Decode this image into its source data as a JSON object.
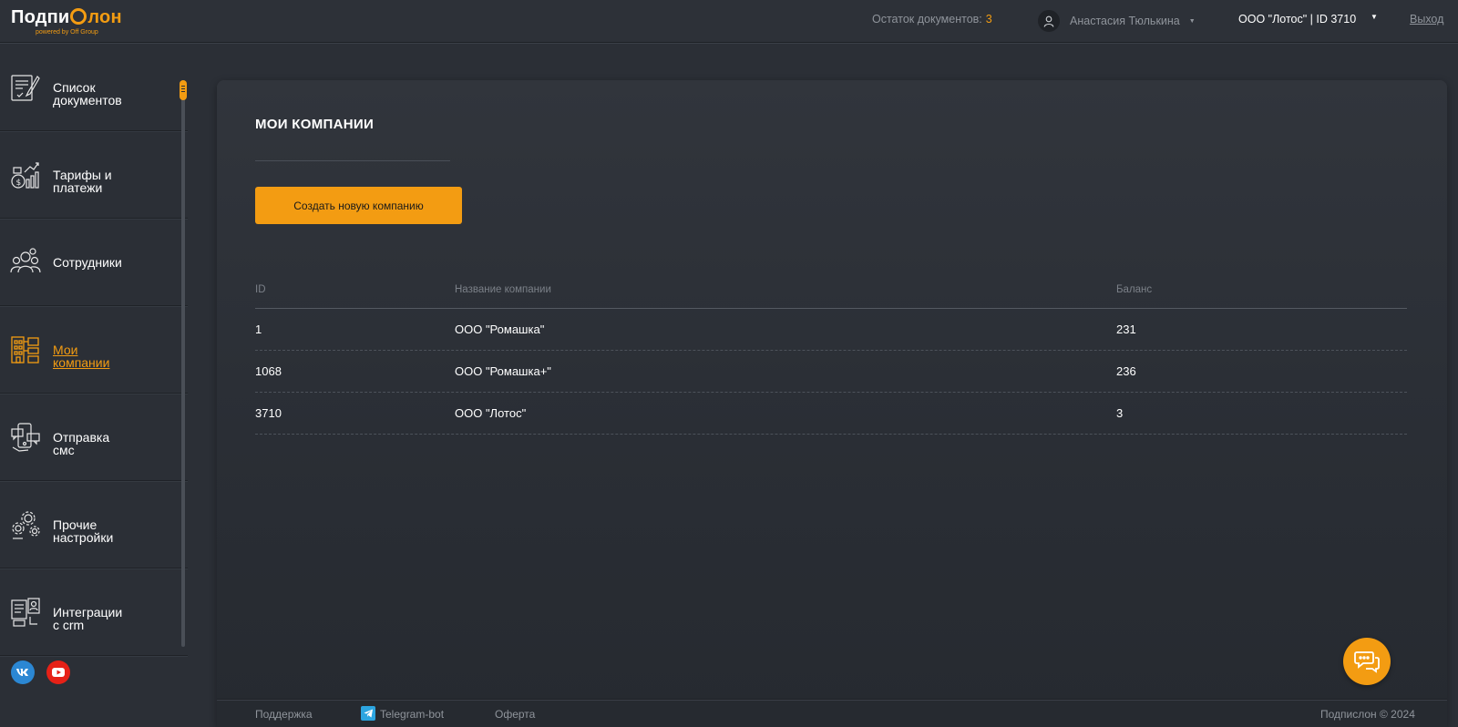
{
  "header": {
    "logo_main": "Подпи",
    "logo_end": "лон",
    "logo_sub": "powered by Off Group",
    "docs_label": "Остаток документов:",
    "docs_count": "3",
    "user_name": "Анастасия Тюлькина",
    "company": "ООО \"Лотос\" | ID 3710",
    "logout": "Выход"
  },
  "sidebar": {
    "items": [
      {
        "label": "Список\nдокументов",
        "icon": "document-list-icon"
      },
      {
        "label": "Тарифы и\nплатежи",
        "icon": "tariffs-icon"
      },
      {
        "label": "Сотрудники",
        "icon": "employees-icon"
      },
      {
        "label": "Мои\nкомпании",
        "icon": "companies-icon",
        "active": true
      },
      {
        "label": "Отправка\nсмс",
        "icon": "sms-icon"
      },
      {
        "label": "Прочие\nнастройки",
        "icon": "settings-icon"
      },
      {
        "label": "Интеграции\nс crm",
        "icon": "crm-icon"
      }
    ],
    "social": [
      "vk-icon",
      "youtube-icon"
    ]
  },
  "main": {
    "title": "МОИ КОМПАНИИ",
    "create_button": "Создать новую компанию",
    "columns": [
      "ID",
      "Название компании",
      "Баланс"
    ],
    "rows": [
      {
        "id": "1",
        "name": "ООО \"Ромашка\"",
        "balance": "231"
      },
      {
        "id": "1068",
        "name": "ООО \"Ромашка+\"",
        "balance": "236"
      },
      {
        "id": "3710",
        "name": "ООО \"Лотос\"",
        "balance": "3"
      }
    ]
  },
  "footer": {
    "support": "Поддержка",
    "telegram": "Telegram-bot",
    "offer": "Оферта",
    "copyright": "Подпислон © 2024"
  },
  "colors": {
    "accent": "#f39c12",
    "background": "#2b2f36",
    "muted_text": "#8f949b"
  }
}
